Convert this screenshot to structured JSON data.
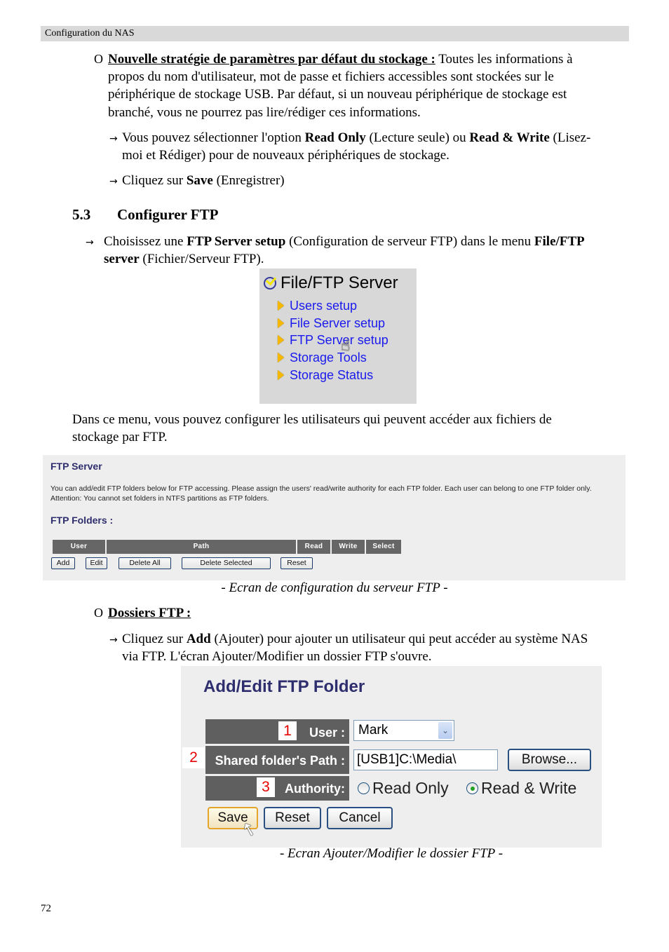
{
  "header": {
    "title": "Configuration du NAS"
  },
  "section_storage": {
    "bullet": "O",
    "heading": "Nouvelle stratégie de paramètres par défaut du stockage :",
    "text_line1": " Toutes les informations à",
    "text_line2": "propos du nom d'utilisateur, mot de passe et fichiers accessibles sont stockées sur le",
    "text_line3": "périphérique de stockage USB. Par défaut, si un nouveau périphérique de stockage est",
    "text_line4": "branché, vous ne pourrez pas lire/rédiger ces informations.",
    "step1": {
      "pre": "Vous pouvez sélectionner l'option ",
      "b1": "Read Only",
      "mid1": " (Lecture seule) ou ",
      "b2": "Read & Write",
      "post": " (Lisez-",
      "line2": "moi et Rédiger) pour de nouveaux périphériques de stockage."
    },
    "step2": {
      "pre": "Cliquez sur ",
      "b": "Save",
      "post": " (Enregistrer)"
    }
  },
  "section_53": {
    "number": "5.3",
    "title": "Configurer FTP",
    "intro": {
      "pre": "Choisissez une ",
      "b1": "FTP Server setup",
      "mid": " (Configuration de serveur FTP) dans le menu ",
      "b2": "File/FTP",
      "b3": "server",
      "post": " (Fichier/Serveur FTP)."
    },
    "menu": {
      "title": "File/FTP Server",
      "items": [
        "Users setup",
        "File Server setup",
        "FTP Server setup",
        "Storage Tools",
        "Storage Status"
      ]
    },
    "para_line1": "Dans ce menu, vous pouvez configurer les utilisateurs qui peuvent accéder aux fichiers de",
    "para_line2": "stockage par FTP."
  },
  "ftp_server_screen": {
    "title": "FTP Server",
    "desc_line1": "You can add/edit FTP folders below for FTP accessing. Please assign the users' read/write authority for each FTP folder. Each user can belong to one FTP folder only.",
    "desc_line2": "Attention: You cannot set folders in NTFS partitions as FTP folders.",
    "folders_title": "FTP Folders  :",
    "columns": [
      "User",
      "Path",
      "Read",
      "Write",
      "Select"
    ],
    "buttons": {
      "add": "Add",
      "edit": "Edit",
      "delete_all": "Delete All",
      "delete_selected": "Delete Selected",
      "reset": "Reset"
    },
    "caption": "- Ecran de configuration du serveur FTP -"
  },
  "section_dossiers": {
    "bullet": "O",
    "heading": "Dossiers FTP :",
    "step": {
      "pre": "Cliquez sur ",
      "b": "Add",
      "post": " (Ajouter) pour ajouter un utilisateur qui peut accéder au système NAS",
      "line2": "via FTP. L'écran Ajouter/Modifier un dossier FTP s'ouvre."
    }
  },
  "edit_ftp_screen": {
    "title": "Add/Edit FTP Folder",
    "fields": {
      "user": {
        "badge": "1",
        "label": "User :",
        "value": "Mark"
      },
      "path": {
        "badge": "2",
        "label": "Shared folder's Path :",
        "value": "[USB1]C:\\Media\\"
      },
      "authority": {
        "badge": "3",
        "label": "Authority:",
        "options": [
          "Read Only",
          "Read & Write"
        ],
        "selected": "Read & Write"
      }
    },
    "buttons": {
      "browse": "Browse...",
      "save": "Save",
      "reset": "Reset",
      "cancel": "Cancel"
    },
    "caption": "- Ecran Ajouter/Modifier le dossier FTP -"
  },
  "icons": {
    "arrow": "→",
    "dropdown": "⌄",
    "hand_cursor": "☝",
    "pointer_cursor": "➚"
  },
  "footer": {
    "page_number": "72"
  }
}
